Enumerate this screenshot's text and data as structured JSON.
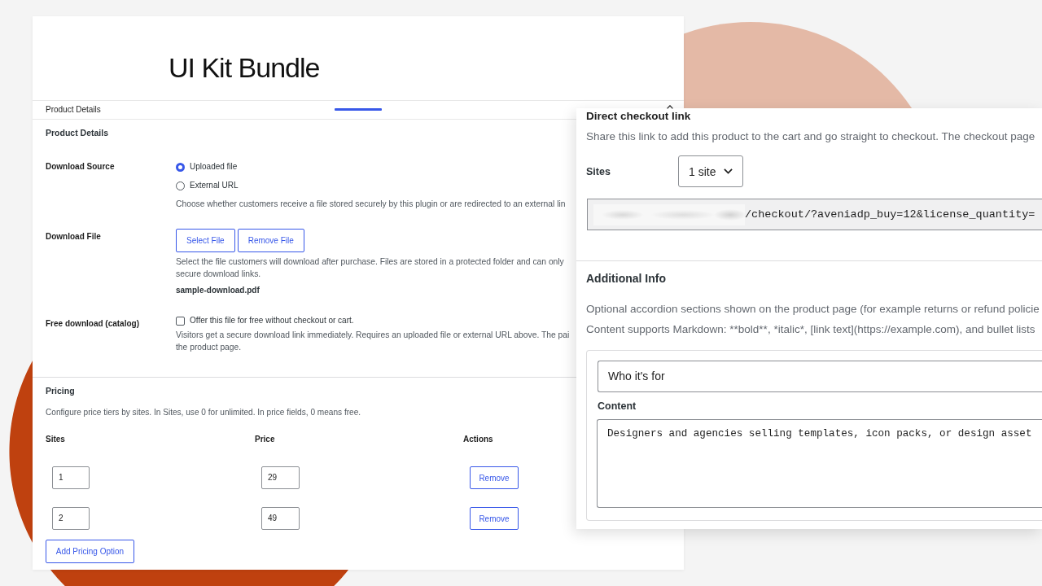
{
  "editor": {
    "title": "UI Kit Bundle",
    "tab": {
      "label": "Product Details"
    },
    "section_title": "Product Details",
    "download_source": {
      "label": "Download Source",
      "options": [
        {
          "label": "Uploaded file",
          "selected": true
        },
        {
          "label": "External URL",
          "selected": false
        }
      ],
      "help": "Choose whether customers receive a file stored securely by this plugin or are redirected to an external lin"
    },
    "download_file": {
      "label": "Download File",
      "buttons": [
        "Select File",
        "Remove File"
      ],
      "help_lines": [
        "Select the file customers will download after purchase. Files are stored in a protected folder and can only",
        "secure download links."
      ],
      "file_name": "sample-download.pdf"
    },
    "free_download": {
      "label": "Free download (catalog)",
      "option": "Offer this file for free without checkout or cart.",
      "checked": false,
      "help_lines": [
        "Visitors get a secure download link immediately. Requires an uploaded file or external URL above. The pai",
        "the product page."
      ]
    },
    "pricing": {
      "title": "Pricing",
      "description": "Configure price tiers by sites. In Sites, use 0 for unlimited. In price fields, 0 means free.",
      "columns": [
        "Sites",
        "Price",
        "Actions"
      ],
      "rows": [
        {
          "sites": "1",
          "price": "29",
          "action": "Remove"
        },
        {
          "sites": "2",
          "price": "49",
          "action": "Remove"
        }
      ],
      "add_button": "Add Pricing Option"
    }
  },
  "checkout_panel": {
    "title": "Direct checkout link",
    "description": "Share this link to add this product to the cart and go straight to checkout. The checkout page",
    "sites_label": "Sites",
    "sites_value": "1 site",
    "link_value": "/checkout/?aveniadp_buy=12&license_quantity=",
    "additional_info": {
      "title": "Additional Info",
      "description_lines": [
        "Optional accordion sections shown on the product page (for example returns or refund policie",
        "Content supports Markdown: **bold**, *italic*, [link text](https://example.com), and bullet lists"
      ],
      "entry": {
        "title_value": "Who it's for",
        "content_label": "Content",
        "content_value": "Designers and agencies selling templates, icon packs, or design asset"
      }
    }
  }
}
